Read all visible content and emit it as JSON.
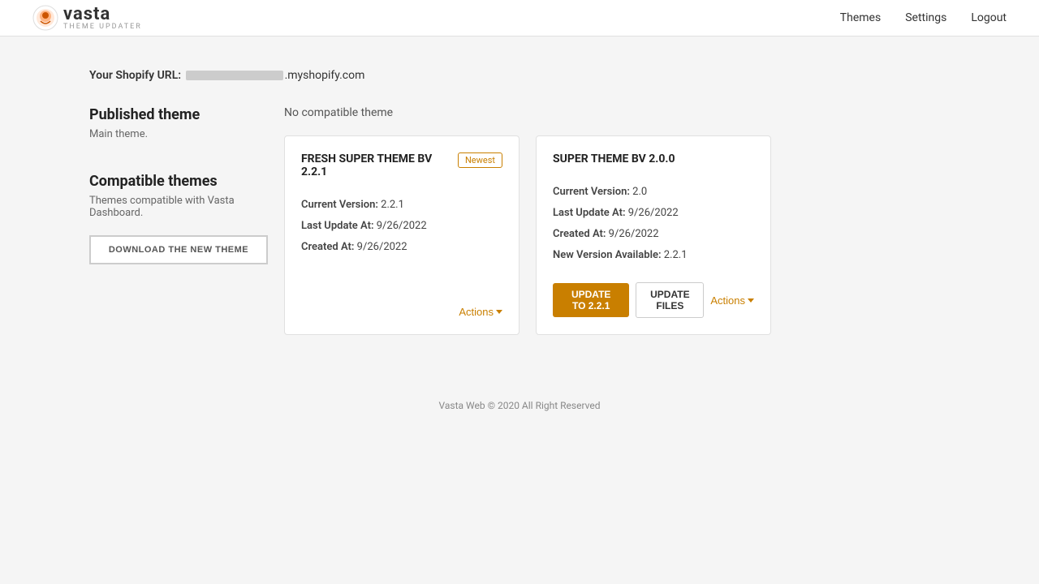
{
  "header": {
    "logo_vasta": "vasta",
    "logo_sub": "THEME UPDATER",
    "nav": {
      "themes": "Themes",
      "settings": "Settings",
      "logout": "Logout"
    }
  },
  "shopify": {
    "label": "Your Shopify URL:",
    "domain": ".myshopify.com"
  },
  "published_theme": {
    "title": "Published theme",
    "subtitle": "Main theme."
  },
  "compatible_themes": {
    "title": "Compatible themes",
    "subtitle": "Themes compatible with Vasta Dashboard.",
    "download_btn": "DOWNLOAD THE NEW THEME"
  },
  "no_compat": "No compatible theme",
  "themes": [
    {
      "name": "FRESH SUPER THEME BV 2.2.1",
      "badge": "Newest",
      "current_version_label": "Current Version:",
      "current_version": "2.2.1",
      "last_update_label": "Last Update At:",
      "last_update": "9/26/2022",
      "created_label": "Created At:",
      "created": "9/26/2022",
      "new_version_label": null,
      "new_version": null,
      "has_update": false,
      "actions_label": "Actions"
    },
    {
      "name": "SUPER THEME BV 2.0.0",
      "badge": null,
      "current_version_label": "Current Version:",
      "current_version": "2.0",
      "last_update_label": "Last Update At:",
      "last_update": "9/26/2022",
      "created_label": "Created At:",
      "created": "9/26/2022",
      "new_version_label": "New Version Available:",
      "new_version": "2.2.1",
      "has_update": true,
      "update_btn": "UPDATE TO 2.2.1",
      "update_files_btn": "UPDATE FILES",
      "actions_label": "Actions"
    }
  ],
  "footer": {
    "text": "Vasta Web © 2020 All Right Reserved"
  }
}
